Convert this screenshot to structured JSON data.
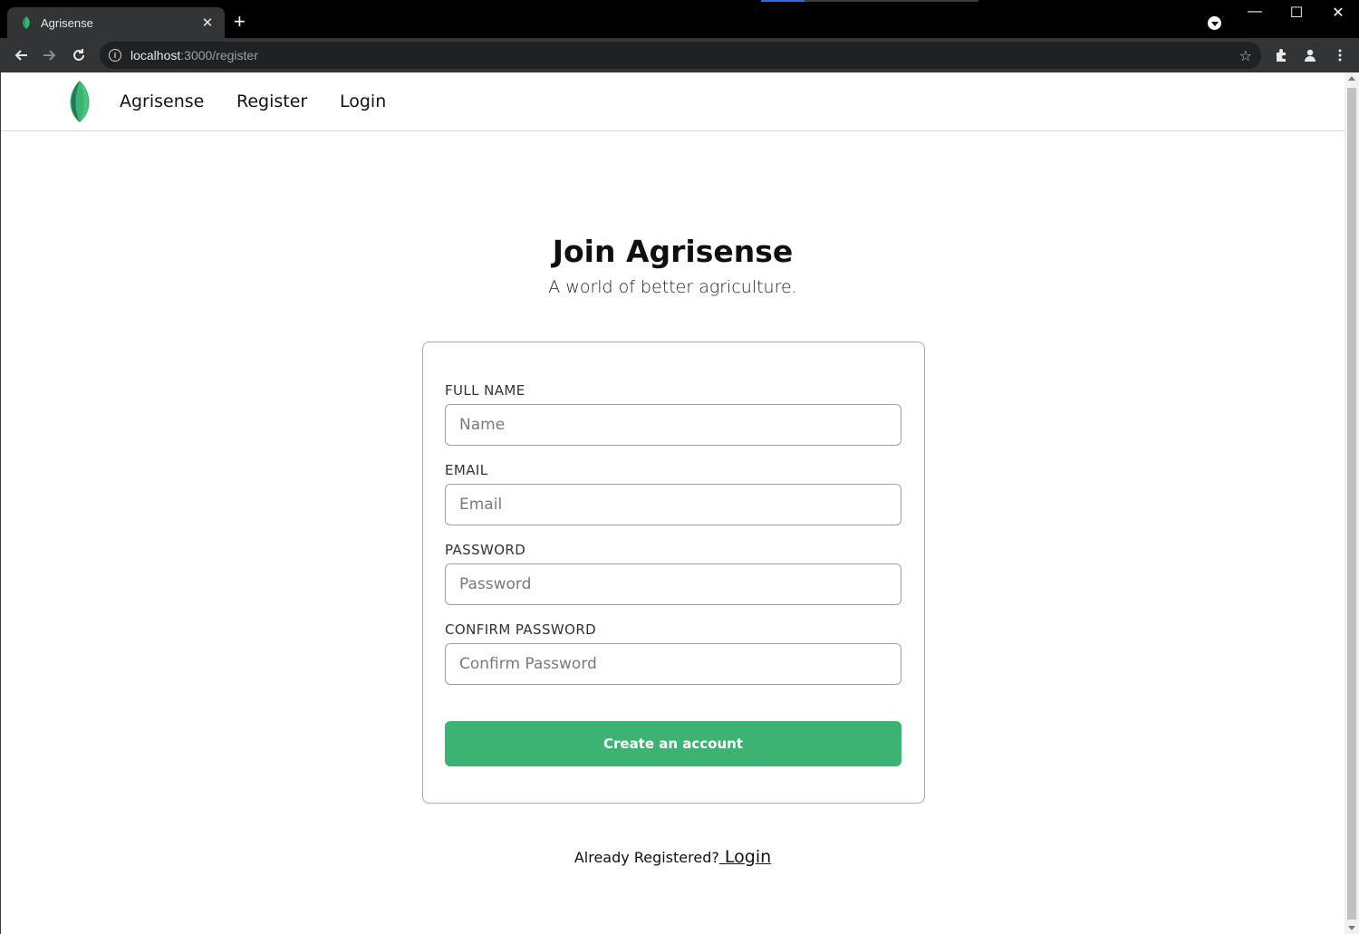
{
  "browser": {
    "tab_title": "Agrisense",
    "tab_close": "✕",
    "new_tab": "+",
    "url_host": "localhost",
    "url_path": ":3000/register",
    "window_controls": {
      "minimize": "—",
      "maximize": "☐",
      "close": "✕"
    }
  },
  "navbar": {
    "brand": "Agrisense",
    "links": [
      "Register",
      "Login"
    ]
  },
  "hero": {
    "title": "Join Agrisense",
    "subtitle": "A world of better agriculture."
  },
  "form": {
    "fields": [
      {
        "label": "FULL NAME",
        "placeholder": "Name",
        "type": "text"
      },
      {
        "label": "EMAIL",
        "placeholder": "Email",
        "type": "email"
      },
      {
        "label": "PASSWORD",
        "placeholder": "Password",
        "type": "password"
      },
      {
        "label": "CONFIRM PASSWORD",
        "placeholder": "Confirm Password",
        "type": "password"
      }
    ],
    "submit_label": "Create an account"
  },
  "footer": {
    "prompt": "Already Registered?",
    "login_link": " Login"
  },
  "colors": {
    "accent": "#3cb371",
    "leaf_dark": "#1f7a5c",
    "leaf_light": "#3cb371"
  },
  "icons": [
    "leaf-logo-icon",
    "info-icon",
    "star-icon",
    "extensions-icon",
    "profile-icon",
    "menu-icon",
    "back-arrow-icon",
    "forward-arrow-icon",
    "reload-icon"
  ]
}
